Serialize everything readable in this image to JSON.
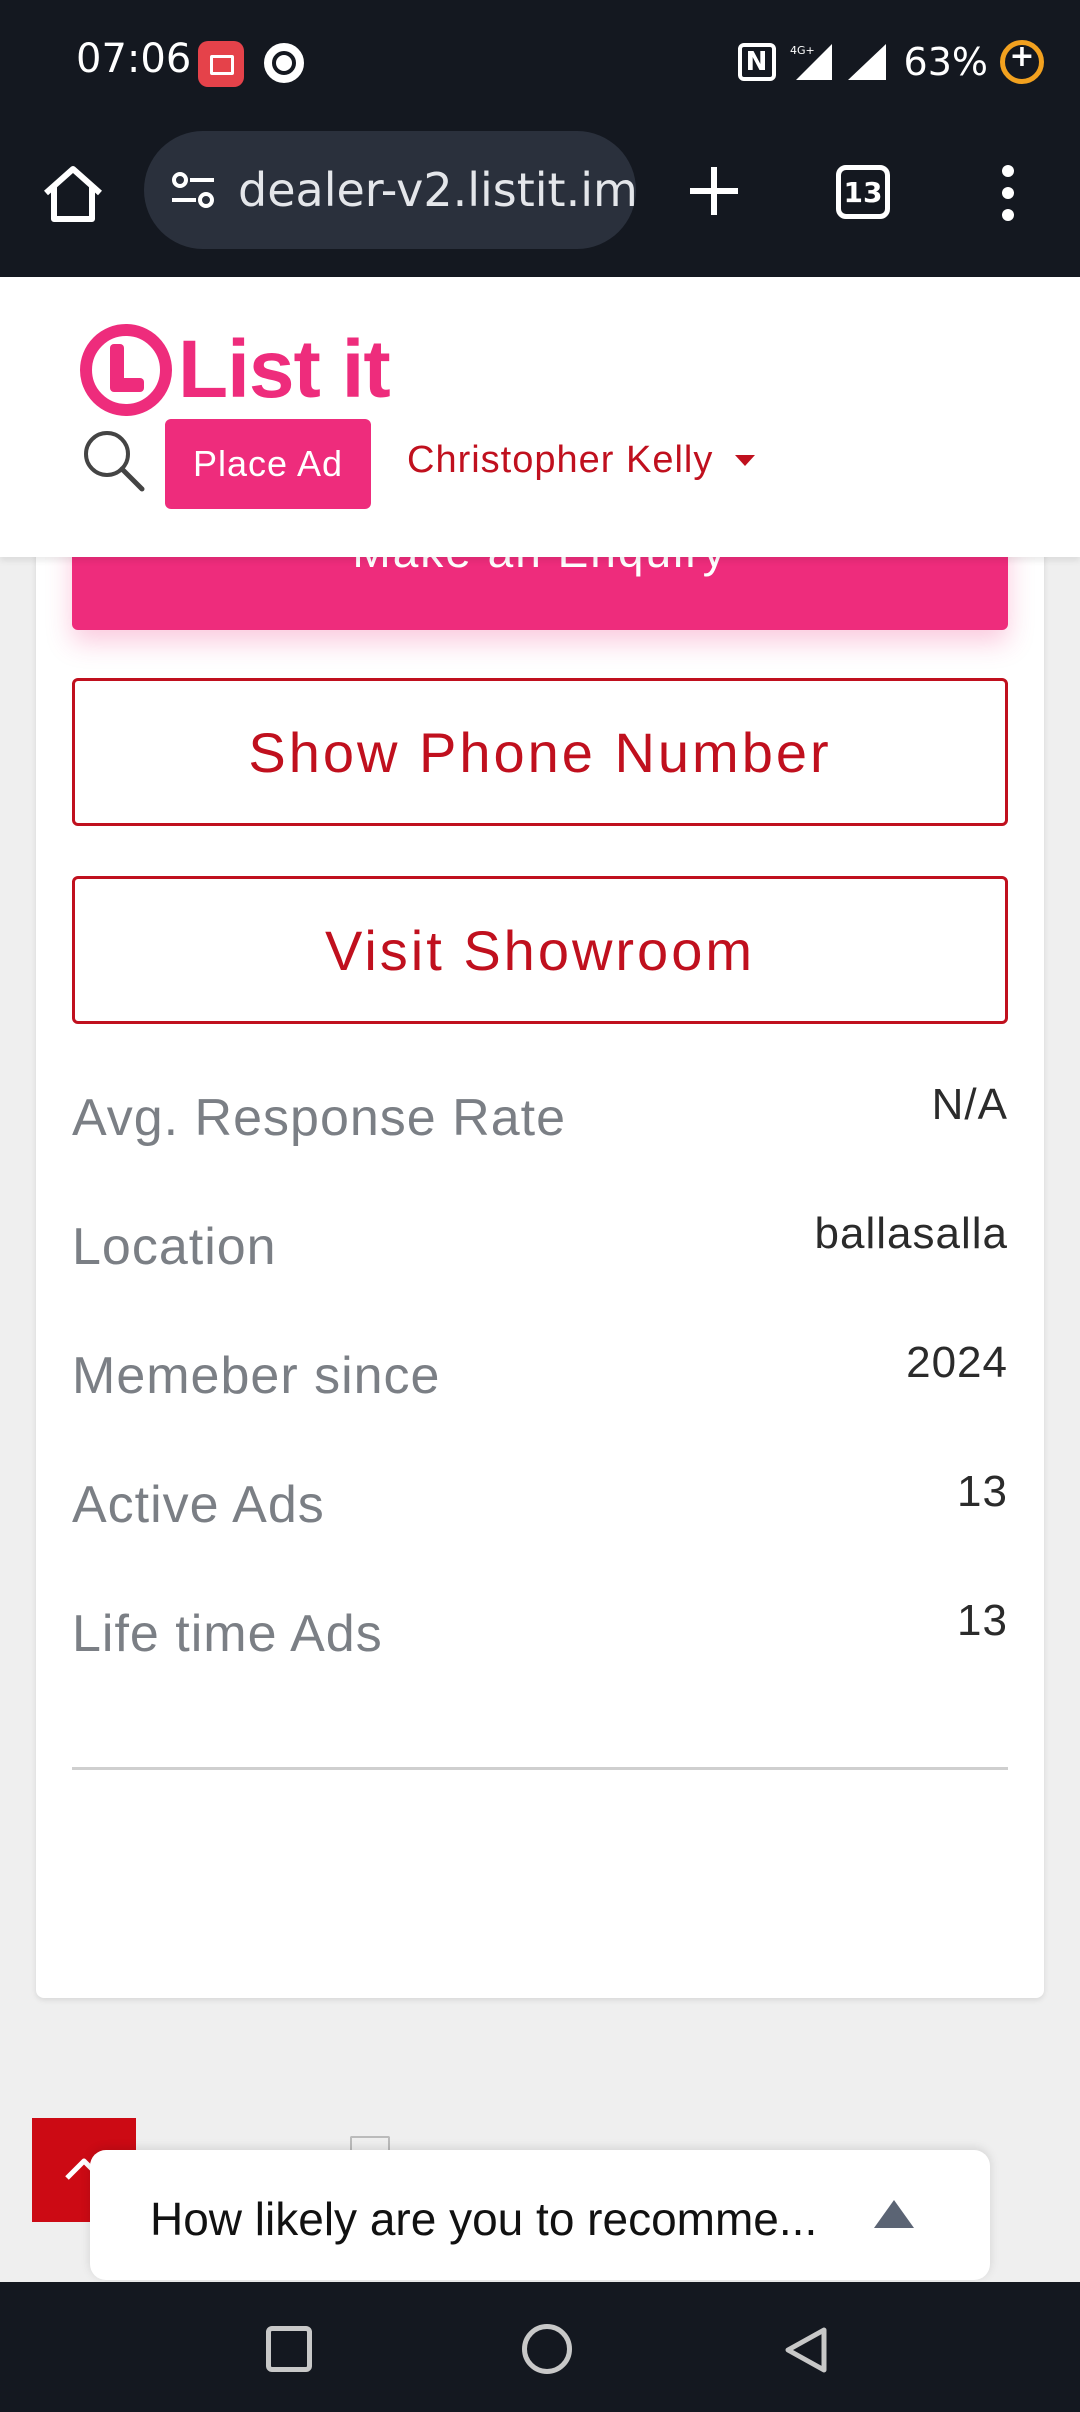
{
  "status_bar": {
    "time": "07:06",
    "network_label": "4G+",
    "battery": "63%"
  },
  "browser": {
    "url": "dealer-v2.listit.im/",
    "tab_count": "13"
  },
  "header": {
    "logo_text": "List it",
    "place_ad_label": "Place Ad",
    "user_name": "Christopher Kelly"
  },
  "dealer_card": {
    "enquiry_label": "Make an Enquiry",
    "show_phone_label": "Show Phone Number",
    "visit_showroom_label": "Visit Showroom",
    "stats": [
      {
        "label": "Avg. Response Rate",
        "value": "N/A"
      },
      {
        "label": "Location",
        "value": "ballasalla"
      },
      {
        "label": "Memeber since",
        "value": "2024"
      },
      {
        "label": "Active Ads",
        "value": "13"
      },
      {
        "label": "Life time Ads",
        "value": "13"
      }
    ]
  },
  "survey": {
    "text": "How likely are you to recomme..."
  },
  "colors": {
    "brand_pink": "#ee2c7c",
    "brand_red": "#c0101e",
    "system_bar": "#141820"
  }
}
